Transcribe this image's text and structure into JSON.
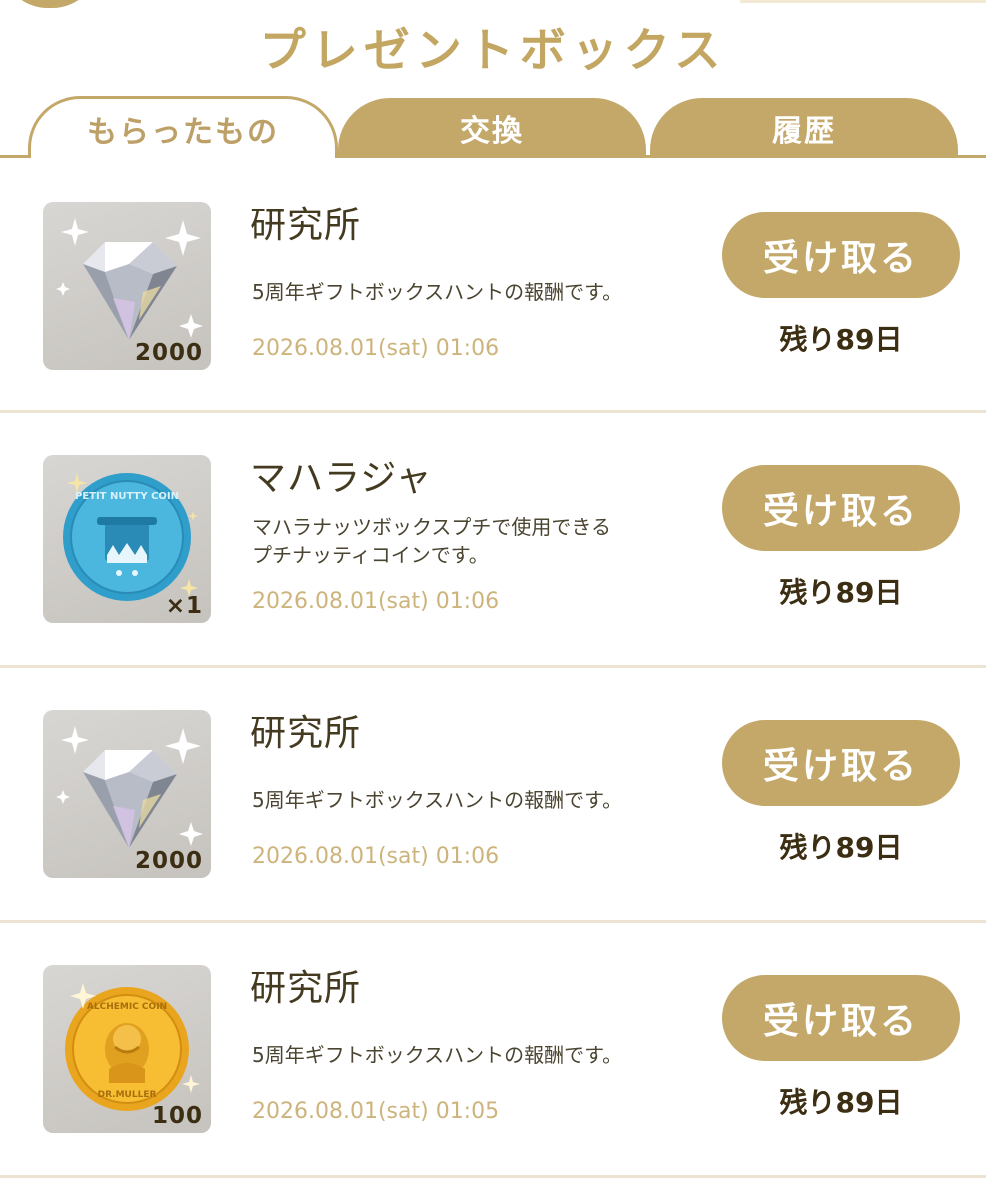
{
  "header": {
    "title": "プレゼントボックス"
  },
  "tabs": [
    {
      "label": "もらったもの",
      "active": true
    },
    {
      "label": "交換",
      "active": false
    },
    {
      "label": "履歴",
      "active": false
    }
  ],
  "colors": {
    "accent": "#c4a86a",
    "date": "#cdb47c",
    "divider": "#ece3d2"
  },
  "items": [
    {
      "icon": "diamond-icon",
      "quantity": "2000",
      "sender": "研究所",
      "description": [
        "5周年ギフトボックスハントの報酬です。"
      ],
      "date": "2026.08.01(sat) 01:06",
      "button": "受け取る",
      "remaining": "残り89日"
    },
    {
      "icon": "blue-coin-icon",
      "quantity": "×1",
      "coin_text": "PETIT NUTTY COIN",
      "sender": "マハラジャ",
      "description": [
        "マハラナッツボックスプチで使用できる",
        "プチナッティコインです。"
      ],
      "date": "2026.08.01(sat) 01:06",
      "button": "受け取る",
      "remaining": "残り89日"
    },
    {
      "icon": "diamond-icon",
      "quantity": "2000",
      "sender": "研究所",
      "description": [
        "5周年ギフトボックスハントの報酬です。"
      ],
      "date": "2026.08.01(sat) 01:06",
      "button": "受け取る",
      "remaining": "残り89日"
    },
    {
      "icon": "gold-coin-icon",
      "quantity": "100",
      "coin_text_top": "ALCHEMIC COIN",
      "coin_text_bottom": "DR.MULLER",
      "sender": "研究所",
      "description": [
        "5周年ギフトボックスハントの報酬です。"
      ],
      "date": "2026.08.01(sat) 01:05",
      "button": "受け取る",
      "remaining": "残り89日"
    }
  ]
}
